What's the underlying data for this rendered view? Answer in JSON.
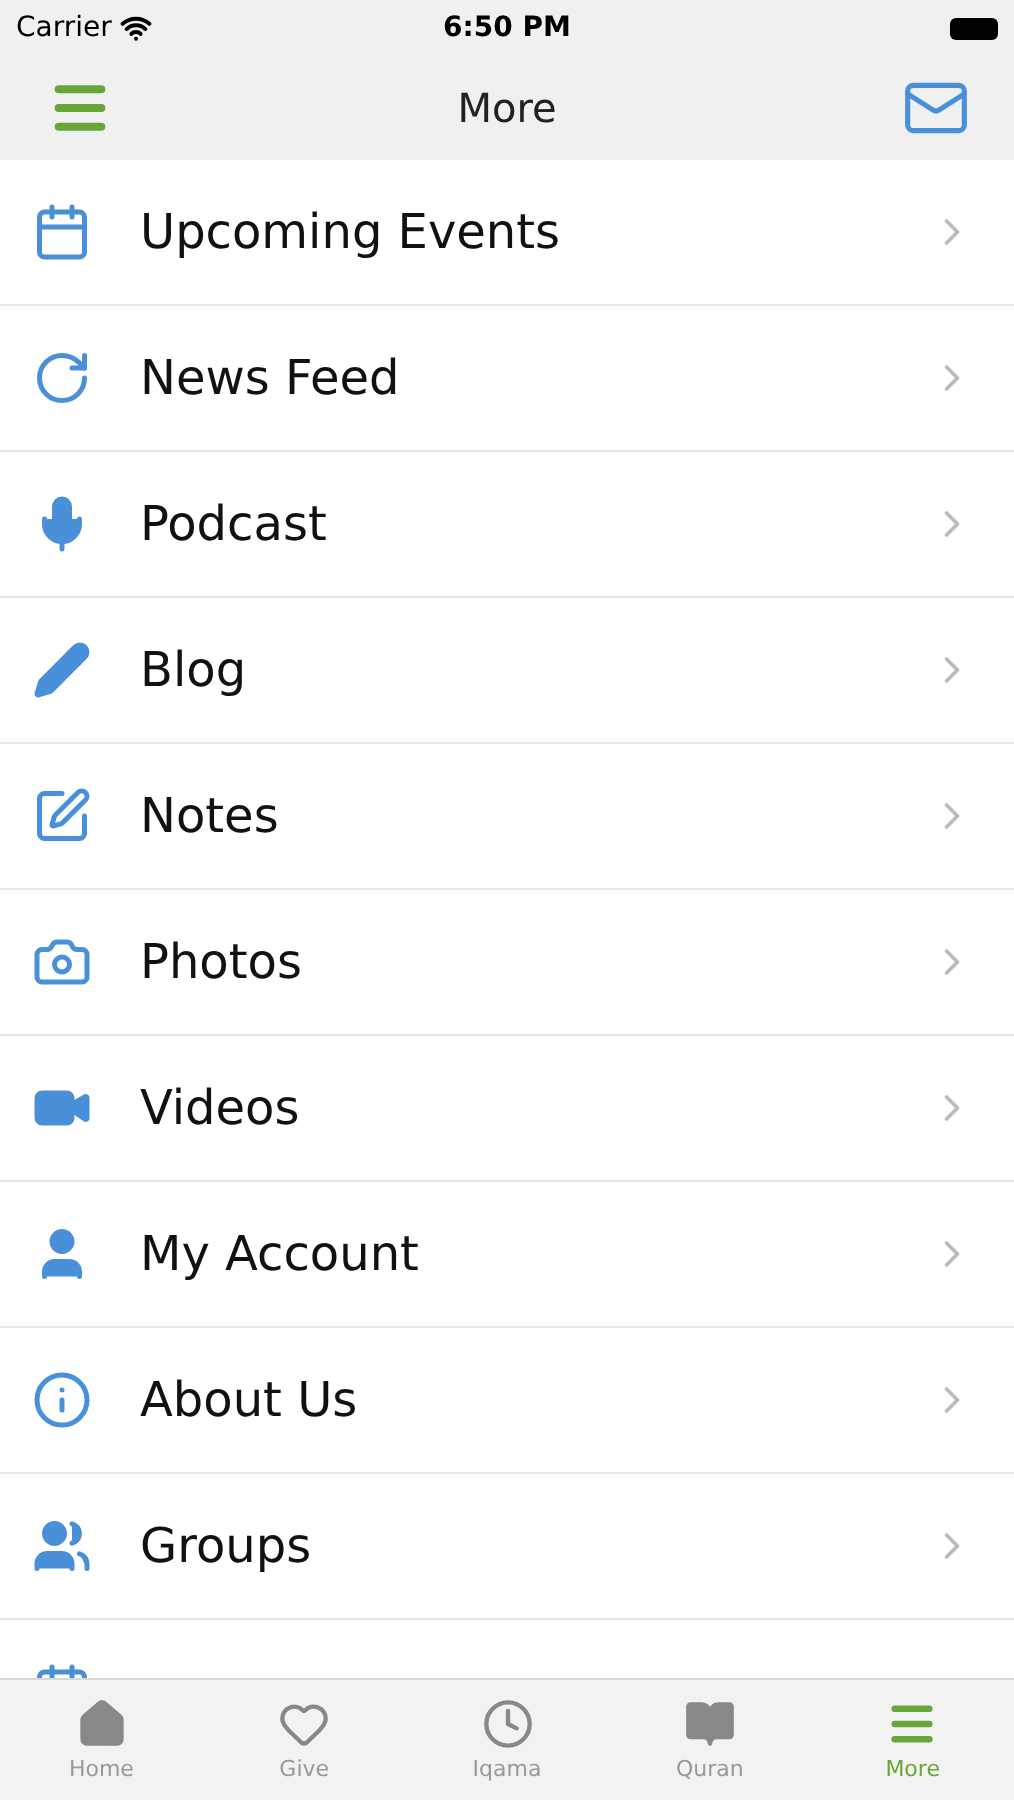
{
  "status_bar": {
    "carrier": "Carrier",
    "time": "6:50 PM"
  },
  "header": {
    "title": "More"
  },
  "items": [
    {
      "label": "Upcoming Events"
    },
    {
      "label": "News Feed"
    },
    {
      "label": "Podcast"
    },
    {
      "label": "Blog"
    },
    {
      "label": "Notes"
    },
    {
      "label": "Photos"
    },
    {
      "label": "Videos"
    },
    {
      "label": "My Account"
    },
    {
      "label": "About Us"
    },
    {
      "label": "Groups"
    }
  ],
  "tabs": [
    {
      "label": "Home",
      "selected": false
    },
    {
      "label": "Give",
      "selected": false
    },
    {
      "label": "Iqama",
      "selected": false
    },
    {
      "label": "Quran",
      "selected": false
    },
    {
      "label": "More",
      "selected": true
    }
  ]
}
